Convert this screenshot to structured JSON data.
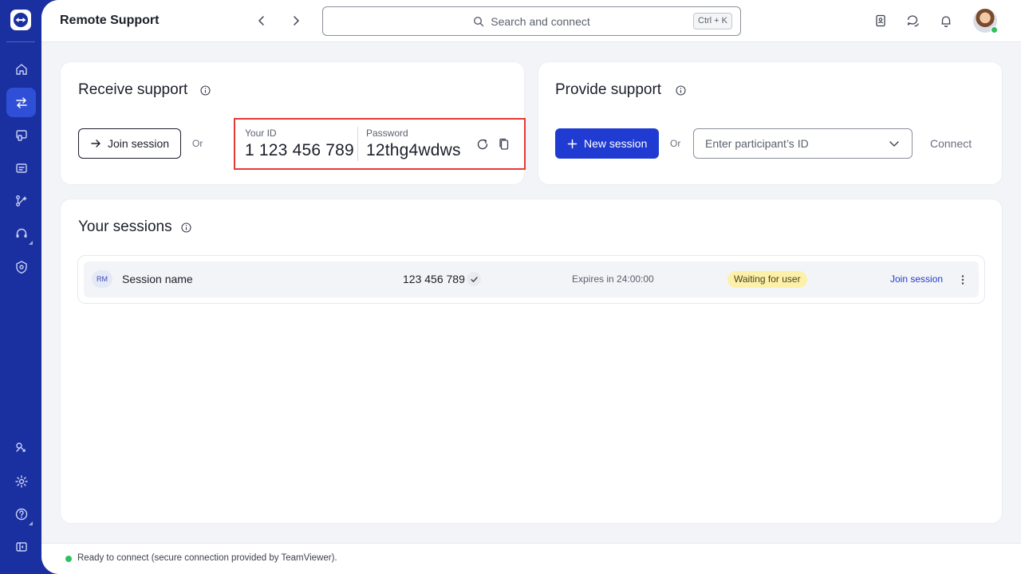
{
  "app": {
    "title": "Remote Support"
  },
  "search": {
    "placeholder": "Search and connect",
    "shortcut": "Ctrl + K"
  },
  "receive_support": {
    "title": "Receive support",
    "join_button": "Join session",
    "or_label": "Or",
    "id_label": "Your ID",
    "id_value": "1 123 456 789",
    "password_label": "Password",
    "password_value": "12thg4wdws"
  },
  "provide_support": {
    "title": "Provide support",
    "new_session_button": "New session",
    "or_label": "Or",
    "participant_placeholder": "Enter participant’s ID",
    "connect_label": "Connect"
  },
  "sessions": {
    "title": "Your sessions",
    "rows": [
      {
        "initials": "RM",
        "name": "Session name",
        "session_id": "123 456 789",
        "expires": "Expires in 24:00:00",
        "status": "Waiting for user",
        "action": "Join session"
      }
    ]
  },
  "footer": {
    "status_text": "Ready to connect (secure connection provided by TeamViewer)."
  },
  "colors": {
    "sidebar": "#1a2fa0",
    "primary": "#1f3bd1",
    "highlight_border": "#e53935",
    "status_badge_bg": "#fdf0a8",
    "online": "#2ec15e"
  },
  "icons": {
    "sidebar": [
      "teamviewer-logo-icon",
      "home-icon",
      "remote-support-icon",
      "devices-icon",
      "monitor-icon",
      "flows-icon",
      "headset-icon",
      "settings-shield-icon",
      "connect-icon",
      "gear-icon",
      "help-icon",
      "collapse-sidebar-icon"
    ],
    "topbar": [
      "back-icon",
      "forward-icon",
      "search-icon",
      "contacts-icon",
      "chat-icon",
      "bell-icon",
      "avatar"
    ]
  }
}
